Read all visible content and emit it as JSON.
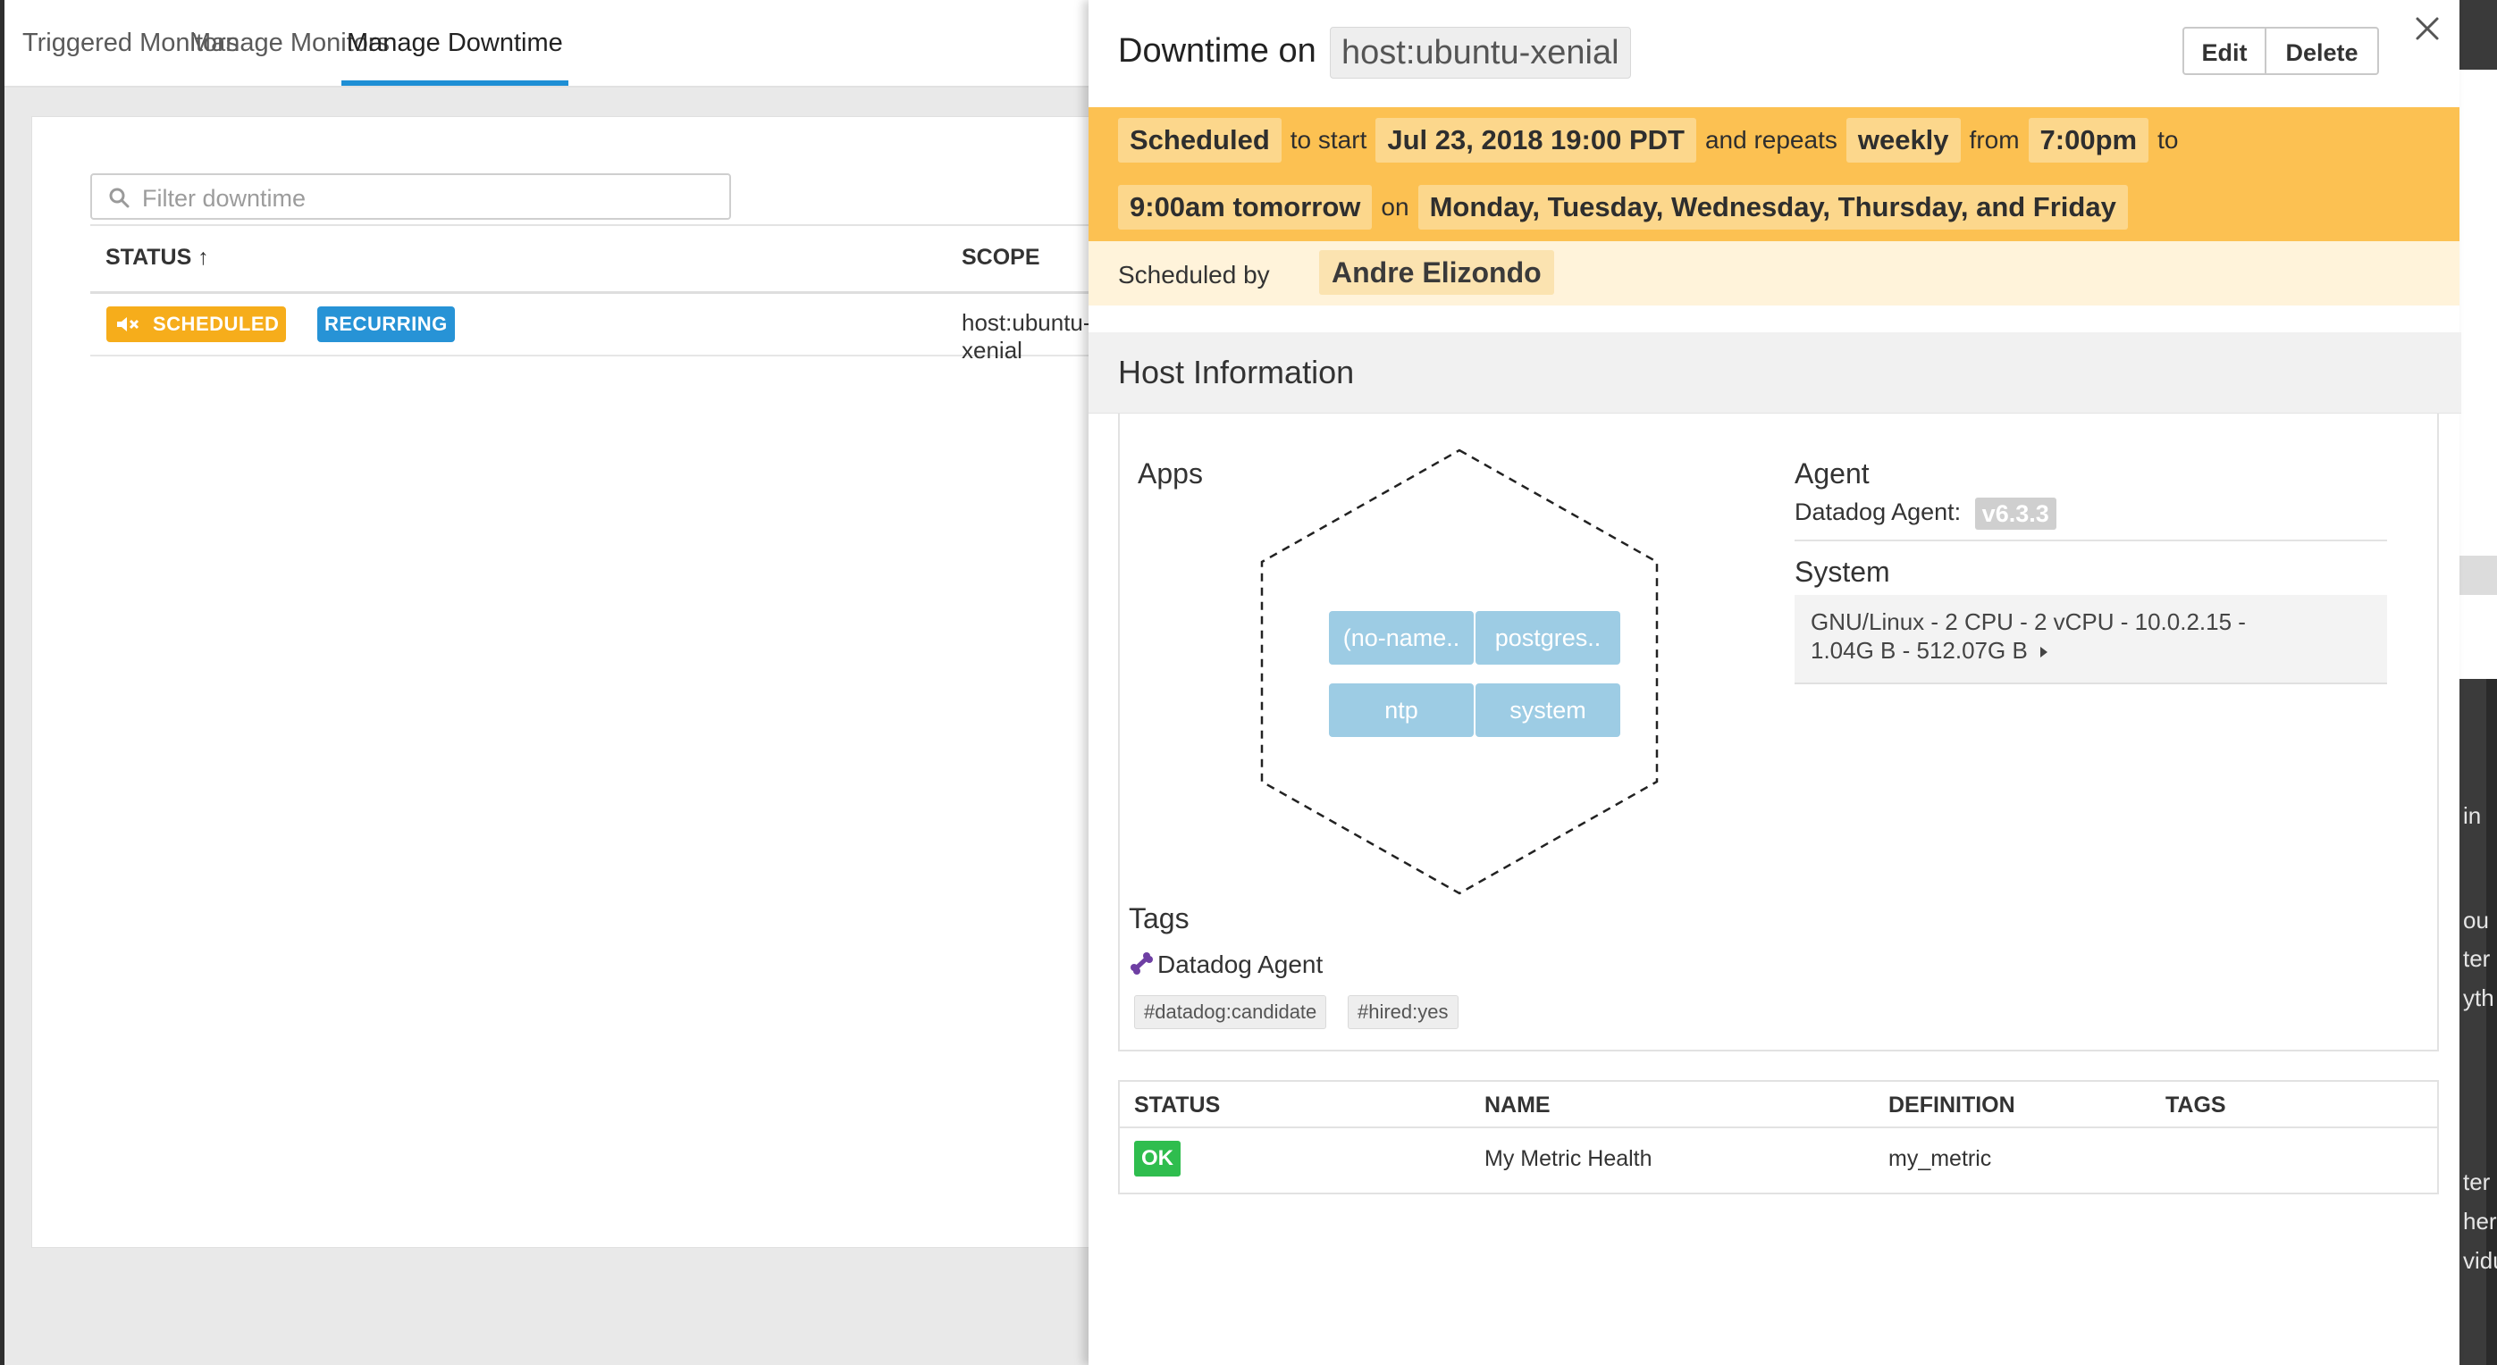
{
  "nav": {
    "tabs": [
      {
        "label": "Triggered Monitors"
      },
      {
        "label": "Manage Monitors"
      },
      {
        "label": "Manage Downtime"
      }
    ],
    "active_tab": "Manage Downtime"
  },
  "downtime_list": {
    "filter_placeholder": "Filter downtime",
    "columns": [
      "STATUS ↑",
      "SCOPE"
    ],
    "rows": [
      {
        "status_badge": "SCHEDULED",
        "recurring_badge": "RECURRING",
        "scope": "host:ubuntu-xenial"
      }
    ]
  },
  "panel": {
    "title_prefix": "Downtime on",
    "host": "host:ubuntu-xenial",
    "edit_label": "Edit",
    "delete_label": "Delete",
    "schedule": {
      "status": "Scheduled",
      "w_to_start": "to start",
      "start": "Jul 23, 2018 19:00 PDT",
      "w_and_repeats": "and repeats",
      "frequency": "weekly",
      "w_from": "from",
      "from_time": "7:00pm",
      "w_to": "to",
      "to_time": "9:00am tomorrow",
      "w_on": "on",
      "days": "Monday, Tuesday, Wednesday, Thursday, and Friday"
    },
    "scheduled_by_label": "Scheduled by",
    "scheduled_by": "Andre Elizondo",
    "host_info": {
      "title": "Host Information",
      "apps_label": "Apps",
      "apps": [
        "(no-name..",
        "postgres..",
        "ntp",
        "system"
      ],
      "agent_title": "Agent",
      "agent_label": "Datadog Agent:",
      "agent_version": "v6.3.3",
      "system_title": "System",
      "system_line1": "GNU/Linux - 2 CPU - 2 vCPU - 10.0.2.15 -",
      "system_line2": "1.04G B - 512.07G B",
      "tags_title": "Tags",
      "tag_group": "Datadog Agent",
      "tags": [
        "#datadog:candidate",
        "#hired:yes"
      ]
    },
    "monitors": {
      "columns": [
        "STATUS",
        "NAME",
        "DEFINITION",
        "TAGS"
      ],
      "rows": [
        {
          "status": "OK",
          "name": "My Metric Health",
          "definition": "my_metric",
          "tags": ""
        }
      ]
    }
  },
  "right_strip": {
    "fragments": [
      "in",
      "ou",
      "ter",
      "yth",
      "ter",
      "her",
      "vidu"
    ]
  },
  "colors": {
    "accent": "#1e8fd5",
    "scheduled_badge": "#f6ad1b",
    "recurring_badge": "#2793d6",
    "schedule_band": "#fcc152",
    "app_chip": "#9dcce4",
    "ok": "#2fbd4e"
  },
  "icons": [
    "search-icon",
    "mute-icon",
    "close-icon",
    "bone-icon",
    "caret-right-icon"
  ]
}
